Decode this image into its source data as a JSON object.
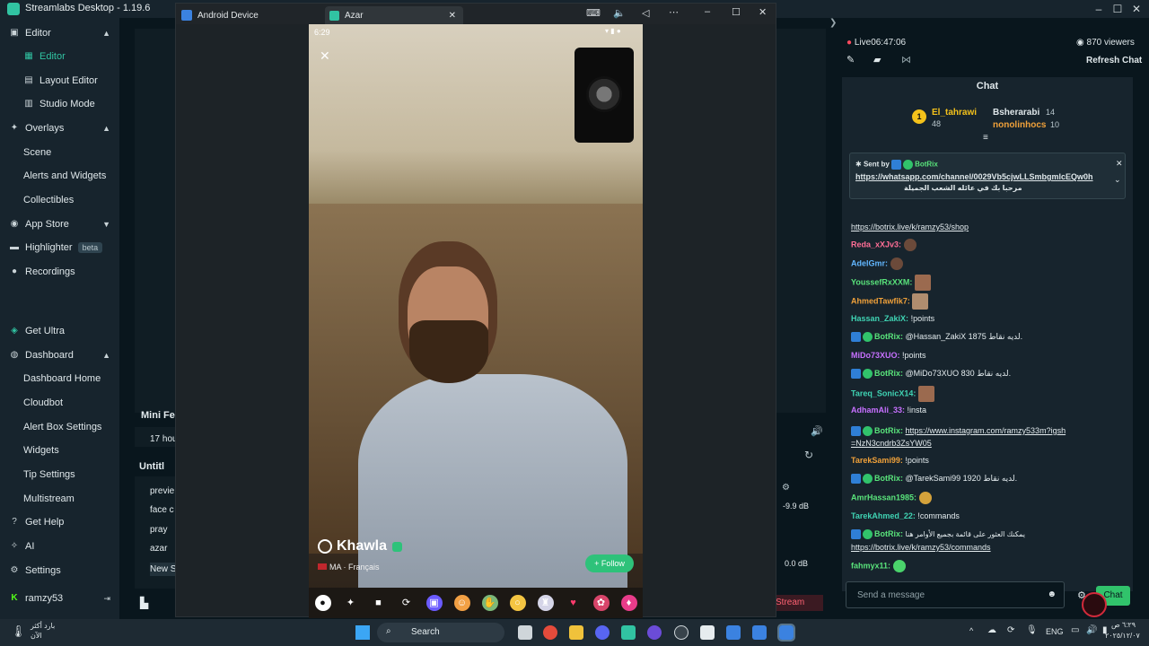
{
  "titlebar": {
    "app_title": "Streamlabs Desktop - 1.19.6"
  },
  "sidebar": {
    "items": [
      {
        "label": "Editor",
        "icon": "editor-icon"
      },
      {
        "label": "Editor",
        "icon": "editor-sub-icon"
      },
      {
        "label": "Layout Editor",
        "icon": "layout-icon"
      },
      {
        "label": "Studio Mode",
        "icon": "studio-icon"
      },
      {
        "label": "Overlays",
        "icon": "overlays-icon"
      },
      {
        "label": "Scene"
      },
      {
        "label": "Alerts and Widgets"
      },
      {
        "label": "Collectibles"
      },
      {
        "label": "App Store",
        "icon": "appstore-icon"
      },
      {
        "label": "Highlighter",
        "icon": "highlighter-icon",
        "badge": "beta"
      },
      {
        "label": "Recordings",
        "icon": "recordings-icon"
      },
      {
        "label": "Get Ultra",
        "icon": "ultra-icon"
      },
      {
        "label": "Dashboard",
        "icon": "dashboard-icon"
      },
      {
        "label": "Dashboard Home"
      },
      {
        "label": "Cloudbot"
      },
      {
        "label": "Alert Box Settings"
      },
      {
        "label": "Widgets"
      },
      {
        "label": "Tip Settings"
      },
      {
        "label": "Multistream"
      },
      {
        "label": "Get Help",
        "icon": "help-icon"
      },
      {
        "label": "AI",
        "icon": "ai-icon"
      },
      {
        "label": "Settings",
        "icon": "settings-icon"
      },
      {
        "label": "ramzy53",
        "icon": "kick-icon"
      }
    ]
  },
  "android": {
    "tabs": [
      {
        "label": "Android Device"
      },
      {
        "label": "Azar"
      }
    ],
    "status_time": "6:29",
    "profile_name": "Khawla",
    "country_code": "MA",
    "language": "Français",
    "follow_label": "+ Follow"
  },
  "editor": {
    "mini_feed_title": "Mini Fe",
    "mini_feed_row": "17 hou",
    "scene_title": "Untitl",
    "sources": [
      "previe",
      "face c",
      "pray",
      "azar",
      "New S"
    ],
    "db_values": [
      "-9.9 dB",
      "0.0 dB"
    ],
    "stream_btn": "Stream"
  },
  "chat": {
    "live_label": "Live",
    "live_time": "06:47:06",
    "viewers": "870 viewers",
    "refresh_label": "Refresh Chat",
    "header": "Chat",
    "leaderboard": [
      {
        "rank": "1",
        "name": "El_tahrawi",
        "points": "48"
      },
      {
        "name": "Bsherarabi",
        "points": "14"
      },
      {
        "name": "nonolinhocs",
        "points": "10"
      }
    ],
    "pinned_sent_by": "Sent by",
    "pinned_bot": "BotRix",
    "pinned_link": "https://whatsapp.com/channel/0029Vb5cjwLLSmbgmlcEQw0h",
    "pinned_text": "مرحبا بك في عائله الشعب الجميلة",
    "messages": [
      {
        "user": "",
        "text": "https://botrix.live/k/ramzy53/shop",
        "link": true
      },
      {
        "user": "Reda_xXJv3:",
        "text": ""
      },
      {
        "user": "AdelGmr:",
        "text": ""
      },
      {
        "user": "YoussefRxXXM:",
        "text": ""
      },
      {
        "user": "AhmedTawfik7:",
        "text": ""
      },
      {
        "user": "Hassan_ZakiX:",
        "text": "!points"
      },
      {
        "user": "BotRix:",
        "text": "@Hassan_ZakiX 1875 لديه نقاط."
      },
      {
        "user": "MiDo73XUO:",
        "text": "!points"
      },
      {
        "user": "BotRix:",
        "text": "@MiDo73XUO 830 لديه نقاط."
      },
      {
        "user": "Tareq_SonicX14:",
        "text": ""
      },
      {
        "user": "AdhamAli_33:",
        "text": "!insta"
      },
      {
        "user": "BotRix:",
        "text": "https://www.instagram.com/ramzy533m?igsh=NzN3cndrb3ZsYW05"
      },
      {
        "user": "TarekSami99:",
        "text": "!points"
      },
      {
        "user": "BotRix:",
        "text": "@TarekSami99 1920 لديه نقاط."
      },
      {
        "user": "AmrHassan1985:",
        "text": ""
      },
      {
        "user": "TarekAhmed_22:",
        "text": "!commands"
      },
      {
        "user": "BotRix:",
        "text": "يمكنك العثور على قائمة بجميع الأوامر هنا"
      },
      {
        "user": "",
        "text": "https://botrix.live/k/ramzy53/commands",
        "link": true
      },
      {
        "user": "fahmyx11:",
        "text": ""
      }
    ],
    "input_placeholder": "Send a message",
    "send_label": "Chat",
    "colors": {
      "green_user": "#59e37b",
      "orange_user": "#f0a13a",
      "pink_user": "#ff6e96",
      "teal_user": "#3fd3b3",
      "purple_user": "#c770ff",
      "blue_user": "#62b7ff"
    }
  },
  "taskbar": {
    "weather_text": "بارد أكثر",
    "weather_sub": "الآن",
    "search_label": "Search",
    "lang": "ENG",
    "time": "٦:٢٩ ص",
    "date": "٢٠٢٥/١٢/٠٧"
  }
}
